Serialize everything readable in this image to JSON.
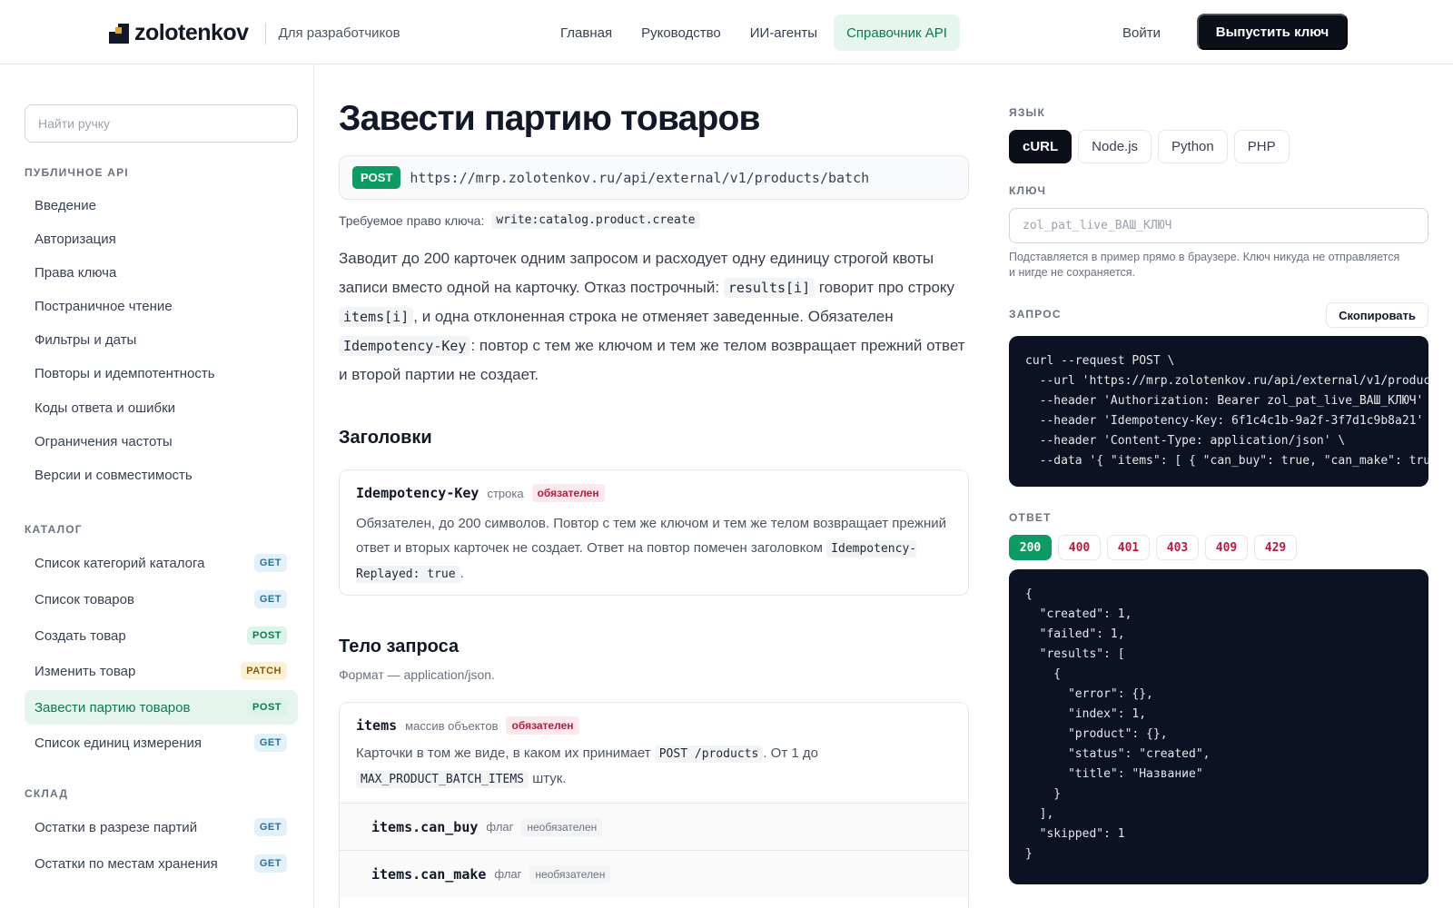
{
  "header": {
    "brand": "zolotenkov",
    "brand_sub": "Для разработчиков",
    "nav": [
      "Главная",
      "Руководство",
      "ИИ-агенты",
      "Справочник API"
    ],
    "nav_active_index": 3,
    "login": "Войти",
    "issue_key": "Выпустить ключ"
  },
  "sidebar": {
    "search_placeholder": "Найти ручку",
    "sections": [
      {
        "title": "ПУБЛИЧНОЕ API",
        "items": [
          {
            "label": "Введение"
          },
          {
            "label": "Авторизация"
          },
          {
            "label": "Права ключа"
          },
          {
            "label": "Постраничное чтение"
          },
          {
            "label": "Фильтры и даты"
          },
          {
            "label": "Повторы и идемпотентность"
          },
          {
            "label": "Коды ответа и ошибки"
          },
          {
            "label": "Ограничения частоты"
          },
          {
            "label": "Версии и совместимость"
          }
        ]
      },
      {
        "title": "КАТАЛОГ",
        "items": [
          {
            "label": "Список категорий каталога",
            "method": "GET"
          },
          {
            "label": "Список товаров",
            "method": "GET"
          },
          {
            "label": "Создать товар",
            "method": "POST"
          },
          {
            "label": "Изменить товар",
            "method": "PATCH"
          },
          {
            "label": "Завести партию товаров",
            "method": "POST",
            "active": true
          },
          {
            "label": "Список единиц измерения",
            "method": "GET"
          }
        ]
      },
      {
        "title": "СКЛАД",
        "items": [
          {
            "label": "Остатки в разрезе партий",
            "method": "GET"
          },
          {
            "label": "Остатки по местам хранения",
            "method": "GET"
          }
        ]
      }
    ]
  },
  "main": {
    "title": "Завести партию товаров",
    "method": "POST",
    "url": "https://mrp.zolotenkov.ru/api/external/v1/products/batch",
    "permission_label": "Требуемое право ключа:",
    "permission": "write:catalog.product.create",
    "description": {
      "p1": "Заводит до 200 карточек одним запросом и расходует одну единицу строгой квоты записи вместо одной на карточку. Отказ построчный:",
      "c1": "results[i]",
      "p2": "говорит про строку",
      "c2": "items[i]",
      "p3": ", и одна отклоненная строка не отменяет заведенные. Обязателен",
      "c3": "Idempotency-Key",
      "p4": ": повтор с тем же ключом и тем же телом возвращает прежний ответ и второй партии не создает."
    },
    "headers_title": "Заголовки",
    "header_param": {
      "name": "Idempotency-Key",
      "type": "строка",
      "required": "обязателен",
      "desc": "Обязателен, до 200 символов. Повтор с тем же ключом и тем же телом возвращает прежний ответ и вторых карточек не создает. Ответ на повтор помечен заголовком",
      "code": "Idempotency-Replayed: true",
      "tail": "."
    },
    "body_title": "Тело запроса",
    "body_format": "Формат — application/json.",
    "body_param": {
      "name": "items",
      "type": "массив объектов",
      "required": "обязателен",
      "desc1": "Карточки в том же виде, в каком их принимает",
      "code1": "POST /products",
      "desc2": ". От 1 до",
      "code2": "MAX_PRODUCT_BATCH_ITEMS",
      "desc3": "штук."
    },
    "sub_params": [
      {
        "name": "items.can_buy",
        "type": "флаг",
        "optional": "необязателен"
      },
      {
        "name": "items.can_make",
        "type": "флаг",
        "optional": "необязателен"
      }
    ]
  },
  "right": {
    "lang_label": "ЯЗЫК",
    "langs": [
      "cURL",
      "Node.js",
      "Python",
      "PHP"
    ],
    "lang_active_index": 0,
    "key_label": "КЛЮЧ",
    "key_placeholder": "zol_pat_live_ВАШ_КЛЮЧ",
    "key_hint": "Подставляется в пример прямо в браузере. Ключ никуда не отправляется и нигде не сохраняется.",
    "request_label": "ЗАПРОС",
    "copy": "Скопировать",
    "request_code": "curl --request POST \\\n  --url 'https://mrp.zolotenkov.ru/api/external/v1/products/batch' \\\n  --header 'Authorization: Bearer zol_pat_live_ВАШ_КЛЮЧ' \\\n  --header 'Idempotency-Key: 6f1c4c1b-9a2f-3f7d1c9b8a21' \\\n  --header 'Content-Type: application/json' \\\n  --data '{ \"items\": [ { \"can_buy\": true, \"can_make\": true } ] }'",
    "response_label": "ОТВЕТ",
    "status_codes": [
      "200",
      "400",
      "401",
      "403",
      "409",
      "429"
    ],
    "status_active_index": 0,
    "response_code": "{\n  \"created\": 1,\n  \"failed\": 1,\n  \"results\": [\n    {\n      \"error\": {},\n      \"index\": 1,\n      \"product\": {},\n      \"status\": \"created\",\n      \"title\": \"Название\"\n    }\n  ],\n  \"skipped\": 1\n}"
  }
}
